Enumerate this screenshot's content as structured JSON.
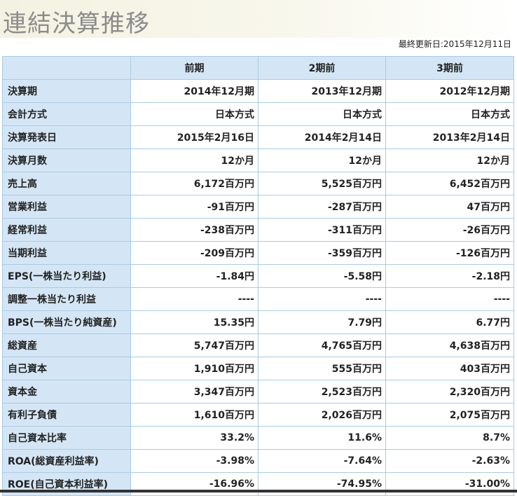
{
  "page": {
    "title": "連結決算推移",
    "last_updated": "最終更新日:2015年12月11日"
  },
  "table": {
    "headers": [
      "",
      "前期",
      "2期前",
      "3期前"
    ],
    "rows": [
      {
        "label": "決算期",
        "values": [
          "2014年12月期",
          "2013年12月期",
          "2012年12月期"
        ]
      },
      {
        "label": "会計方式",
        "values": [
          "日本方式",
          "日本方式",
          "日本方式"
        ]
      },
      {
        "label": "決算発表日",
        "values": [
          "2015年2月16日",
          "2014年2月14日",
          "2013年2月14日"
        ]
      },
      {
        "label": "決算月数",
        "values": [
          "12か月",
          "12か月",
          "12か月"
        ]
      },
      {
        "label": "売上高",
        "values": [
          "6,172百万円",
          "5,525百万円",
          "6,452百万円"
        ]
      },
      {
        "label": "営業利益",
        "values": [
          "-91百万円",
          "-287百万円",
          "47百万円"
        ]
      },
      {
        "label": "経常利益",
        "values": [
          "-238百万円",
          "-311百万円",
          "-26百万円"
        ]
      },
      {
        "label": "当期利益",
        "values": [
          "-209百万円",
          "-359百万円",
          "-126百万円"
        ]
      },
      {
        "label": "EPS(一株当たり利益)",
        "values": [
          "-1.84円",
          "-5.58円",
          "-2.18円"
        ]
      },
      {
        "label": "調整一株当たり利益",
        "values": [
          "----",
          "----",
          "----"
        ]
      },
      {
        "label": "BPS(一株当たり純資産)",
        "values": [
          "15.35円",
          "7.79円",
          "6.77円"
        ]
      },
      {
        "label": "総資産",
        "values": [
          "5,747百万円",
          "4,765百万円",
          "4,638百万円"
        ]
      },
      {
        "label": "自己資本",
        "values": [
          "1,910百万円",
          "555百万円",
          "403百万円"
        ]
      },
      {
        "label": "資本金",
        "values": [
          "3,347百万円",
          "2,523百万円",
          "2,320百万円"
        ]
      },
      {
        "label": "有利子負債",
        "values": [
          "1,610百万円",
          "2,026百万円",
          "2,075百万円"
        ]
      },
      {
        "label": "自己資本比率",
        "values": [
          "33.2%",
          "11.6%",
          "8.7%"
        ]
      },
      {
        "label": "ROA(総資産利益率)",
        "values": [
          "-3.98%",
          "-7.64%",
          "-2.63%"
        ]
      },
      {
        "label": "ROE(自己資本利益率)",
        "values": [
          "-16.96%",
          "-74.95%",
          "-31.00%"
        ]
      }
    ]
  }
}
